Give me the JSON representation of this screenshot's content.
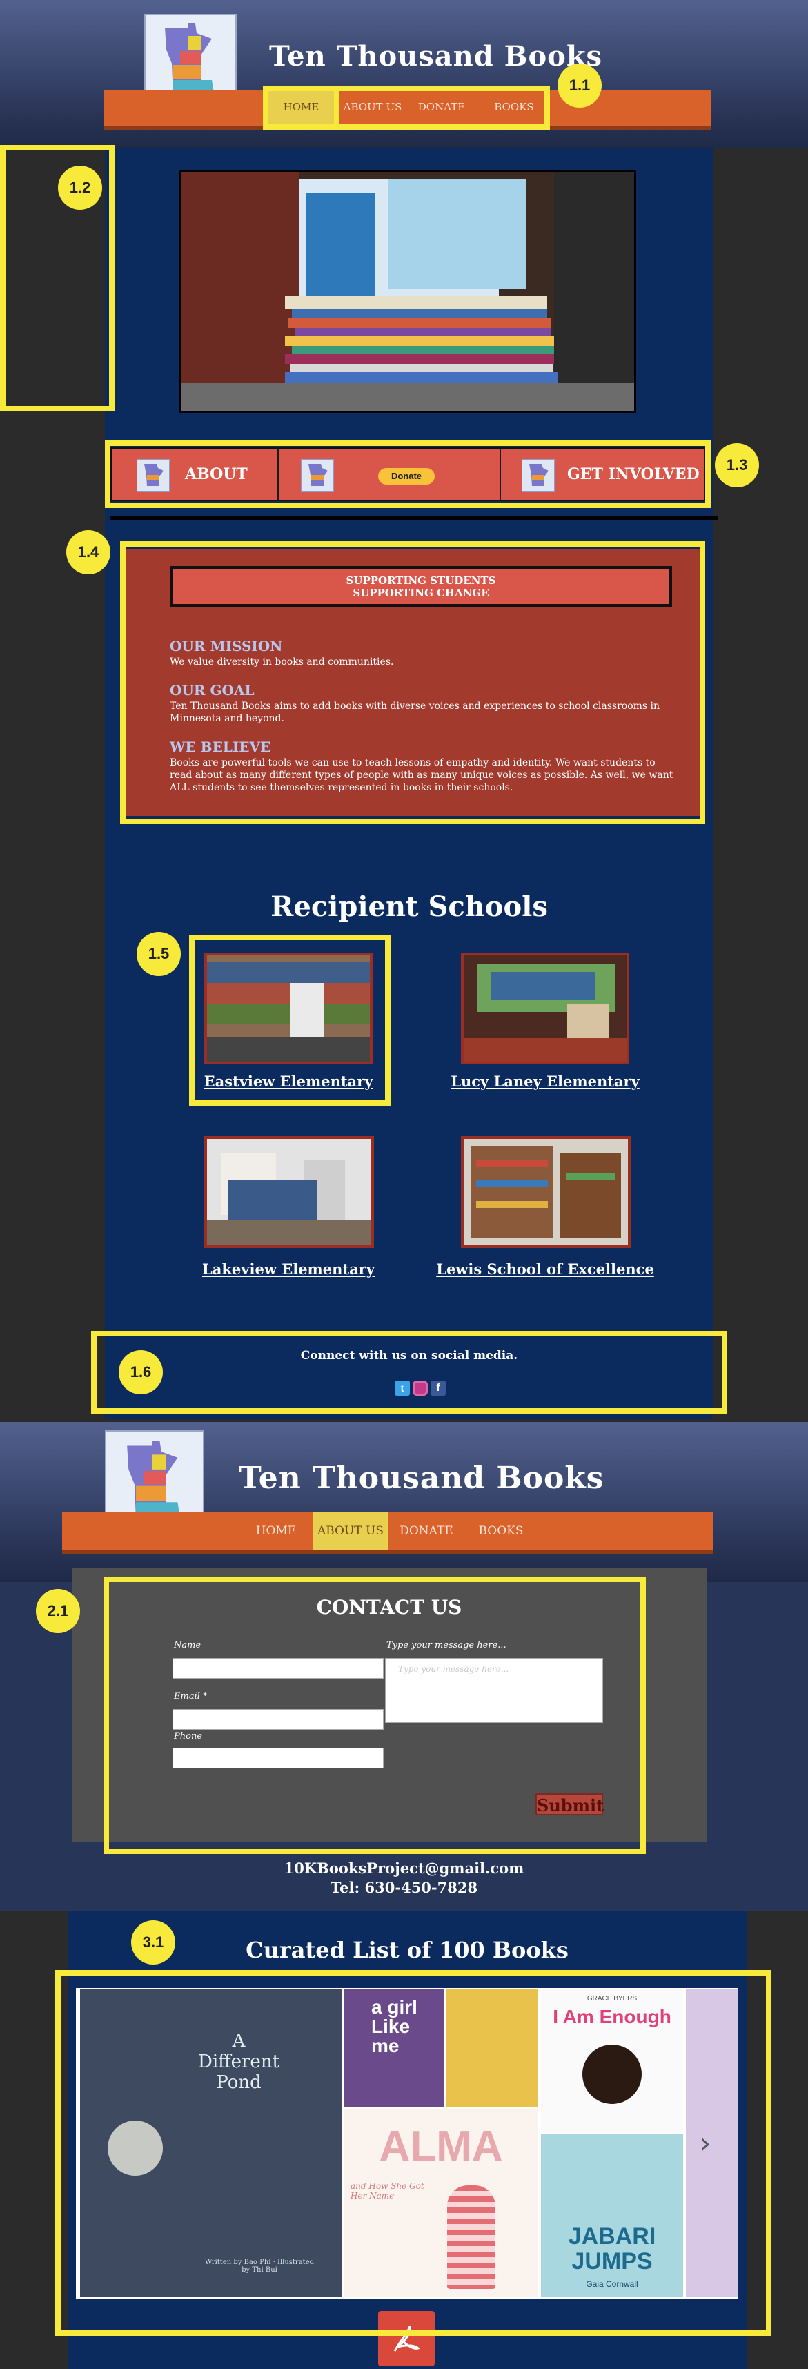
{
  "site": {
    "title": "Ten Thousand Books"
  },
  "nav": {
    "home": "HOME",
    "about": "ABOUT US",
    "donate": "DONATE",
    "books": "BOOKS"
  },
  "badges": {
    "b11": "1.1",
    "b12": "1.2",
    "b13": "1.3",
    "b14": "1.4",
    "b15": "1.5",
    "b16": "1.6",
    "b21": "2.1",
    "b31": "3.1"
  },
  "cta": {
    "about": "ABOUT",
    "donate_btn": "Donate",
    "involved": "GET INVOLVED"
  },
  "mission": {
    "banner_line1": "SUPPORTING STUDENTS",
    "banner_line2": "SUPPORTING CHANGE",
    "h1": "OUR MISSION",
    "p1": "We value diversity in books and communities.",
    "h2": "OUR GOAL",
    "p2": "Ten Thousand Books aims to add books with diverse voices and experiences to school classrooms in Minnesota and beyond.",
    "h3": "WE BELIEVE",
    "p3": "Books are powerful tools we can use to teach lessons of empathy and identity. We want students to read about as many different types of people with as many unique voices as possible. As well, we want ALL students to see themselves represented in books in their schools."
  },
  "schools": {
    "title": "Recipient Schools",
    "items": [
      "Eastview Elementary",
      "Lucy Laney Elementary",
      "Lakeview Elementary",
      "Lewis School of Excellence"
    ]
  },
  "social": {
    "text": "Connect with us on social media.",
    "icons": [
      "twitter-icon",
      "instagram-icon",
      "facebook-icon"
    ]
  },
  "contact": {
    "title": "CONTACT US",
    "name_label": "Name",
    "email_label": "Email *",
    "phone_label": "Phone",
    "message_label": "Type your message here...",
    "message_placeholder": "Type your message here...",
    "submit": "Submit",
    "email": "10KBooksProject@gmail.com",
    "tel": "Tel: 630-450-7828"
  },
  "books": {
    "title": "Curated List of 100 Books",
    "covers": [
      {
        "title": "A Different Pond",
        "subtitle": "Written by Bao Phi · Illustrated by Thi Bui"
      },
      {
        "title": "a girl Like me",
        "subtitle": ""
      },
      {
        "title": "",
        "subtitle": ""
      },
      {
        "title": "I Am Enough",
        "subtitle": "GRACE BYERS"
      },
      {
        "title": "ALMA",
        "subtitle": "and How She Got Her Name"
      },
      {
        "title": "JABARI JUMPS",
        "subtitle": "Gaia Cornwall"
      }
    ],
    "next": "›"
  },
  "colors": {
    "highlight": "#f7ea3a",
    "orange": "#d9622b",
    "navy": "#0b2b5e",
    "red": "#d9574a"
  }
}
